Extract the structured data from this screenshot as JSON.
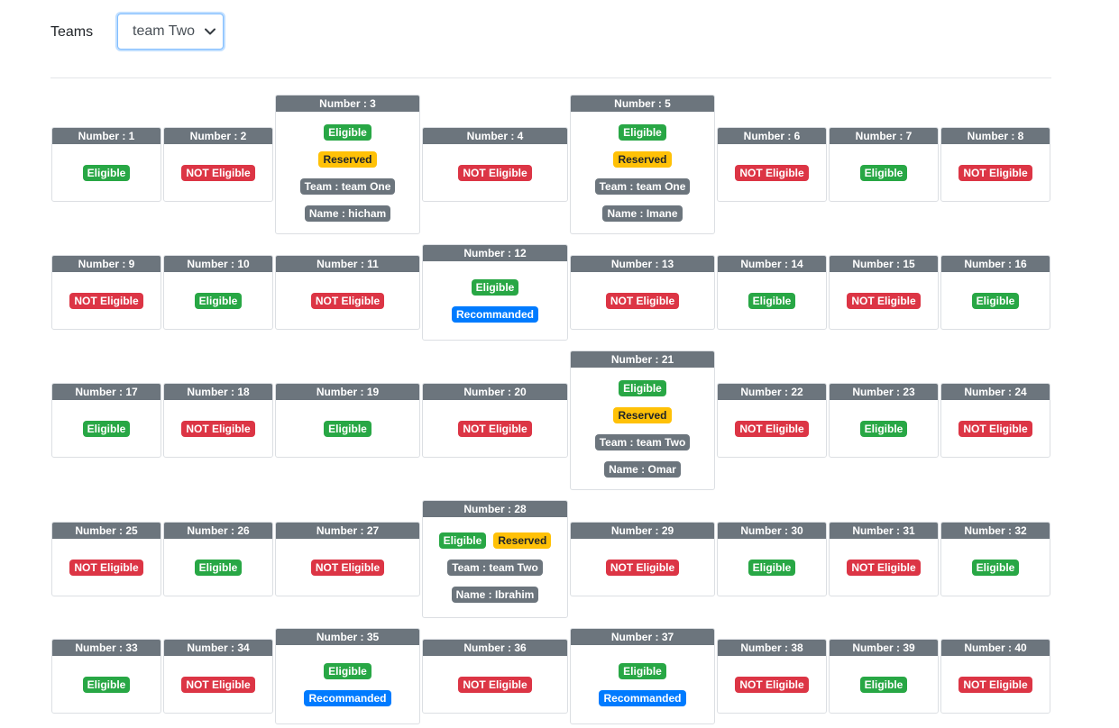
{
  "filter": {
    "label": "Teams",
    "selected": "team Two"
  },
  "colors": {
    "eligible": "#28a745",
    "not_eligible": "#dc3545",
    "reserved": "#ffc107",
    "recommended": "#007bff",
    "header": "#6c757d"
  },
  "cards": [
    {
      "title": "Number : 1",
      "badges": [
        {
          "text": "Eligible",
          "type": "eligible"
        }
      ]
    },
    {
      "title": "Number : 2",
      "badges": [
        {
          "text": "NOT Eligible",
          "type": "not-eligible"
        }
      ]
    },
    {
      "title": "Number : 3",
      "badges": [
        {
          "text": "Eligible",
          "type": "eligible"
        },
        {
          "text": "Reserved",
          "type": "reserved"
        },
        {
          "text": "Team : team One",
          "type": "info"
        },
        {
          "text": "Name : hicham",
          "type": "info"
        }
      ]
    },
    {
      "title": "Number : 4",
      "badges": [
        {
          "text": "NOT Eligible",
          "type": "not-eligible"
        }
      ]
    },
    {
      "title": "Number : 5",
      "badges": [
        {
          "text": "Eligible",
          "type": "eligible"
        },
        {
          "text": "Reserved",
          "type": "reserved"
        },
        {
          "text": "Team : team One",
          "type": "info"
        },
        {
          "text": "Name : Imane",
          "type": "info"
        }
      ]
    },
    {
      "title": "Number : 6",
      "badges": [
        {
          "text": "NOT Eligible",
          "type": "not-eligible"
        }
      ]
    },
    {
      "title": "Number : 7",
      "badges": [
        {
          "text": "Eligible",
          "type": "eligible"
        }
      ]
    },
    {
      "title": "Number : 8",
      "badges": [
        {
          "text": "NOT Eligible",
          "type": "not-eligible"
        }
      ]
    },
    {
      "title": "Number : 9",
      "badges": [
        {
          "text": "NOT Eligible",
          "type": "not-eligible"
        }
      ]
    },
    {
      "title": "Number : 10",
      "badges": [
        {
          "text": "Eligible",
          "type": "eligible"
        }
      ]
    },
    {
      "title": "Number : 11",
      "badges": [
        {
          "text": "NOT Eligible",
          "type": "not-eligible"
        }
      ]
    },
    {
      "title": "Number : 12",
      "badges": [
        {
          "text": "Eligible",
          "type": "eligible"
        },
        {
          "text": "Recommanded",
          "type": "recommended"
        }
      ]
    },
    {
      "title": "Number : 13",
      "badges": [
        {
          "text": "NOT Eligible",
          "type": "not-eligible"
        }
      ]
    },
    {
      "title": "Number : 14",
      "badges": [
        {
          "text": "Eligible",
          "type": "eligible"
        }
      ]
    },
    {
      "title": "Number : 15",
      "badges": [
        {
          "text": "NOT Eligible",
          "type": "not-eligible"
        }
      ]
    },
    {
      "title": "Number : 16",
      "badges": [
        {
          "text": "Eligible",
          "type": "eligible"
        }
      ]
    },
    {
      "title": "Number : 17",
      "badges": [
        {
          "text": "Eligible",
          "type": "eligible"
        }
      ]
    },
    {
      "title": "Number : 18",
      "badges": [
        {
          "text": "NOT Eligible",
          "type": "not-eligible"
        }
      ]
    },
    {
      "title": "Number : 19",
      "badges": [
        {
          "text": "Eligible",
          "type": "eligible"
        }
      ]
    },
    {
      "title": "Number : 20",
      "badges": [
        {
          "text": "NOT Eligible",
          "type": "not-eligible"
        }
      ]
    },
    {
      "title": "Number : 21",
      "badges": [
        {
          "text": "Eligible",
          "type": "eligible"
        },
        {
          "text": "Reserved",
          "type": "reserved"
        },
        {
          "text": "Team : team Two",
          "type": "info"
        },
        {
          "text": "Name : Omar",
          "type": "info"
        }
      ]
    },
    {
      "title": "Number : 22",
      "badges": [
        {
          "text": "NOT Eligible",
          "type": "not-eligible"
        }
      ]
    },
    {
      "title": "Number : 23",
      "badges": [
        {
          "text": "Eligible",
          "type": "eligible"
        }
      ]
    },
    {
      "title": "Number : 24",
      "badges": [
        {
          "text": "NOT Eligible",
          "type": "not-eligible"
        }
      ]
    },
    {
      "title": "Number : 25",
      "badges": [
        {
          "text": "NOT Eligible",
          "type": "not-eligible"
        }
      ]
    },
    {
      "title": "Number : 26",
      "badges": [
        {
          "text": "Eligible",
          "type": "eligible"
        }
      ]
    },
    {
      "title": "Number : 27",
      "badges": [
        {
          "text": "NOT Eligible",
          "type": "not-eligible"
        }
      ]
    },
    {
      "title": "Number : 28",
      "badges": [
        {
          "text": "Eligible",
          "type": "eligible"
        },
        {
          "text": "Reserved",
          "type": "reserved"
        },
        {
          "text": "Team : team Two",
          "type": "info"
        },
        {
          "text": "Name : Ibrahim",
          "type": "info"
        }
      ]
    },
    {
      "title": "Number : 29",
      "badges": [
        {
          "text": "NOT Eligible",
          "type": "not-eligible"
        }
      ]
    },
    {
      "title": "Number : 30",
      "badges": [
        {
          "text": "Eligible",
          "type": "eligible"
        }
      ]
    },
    {
      "title": "Number : 31",
      "badges": [
        {
          "text": "NOT Eligible",
          "type": "not-eligible"
        }
      ]
    },
    {
      "title": "Number : 32",
      "badges": [
        {
          "text": "Eligible",
          "type": "eligible"
        }
      ]
    },
    {
      "title": "Number : 33",
      "badges": [
        {
          "text": "Eligible",
          "type": "eligible"
        }
      ]
    },
    {
      "title": "Number : 34",
      "badges": [
        {
          "text": "NOT Eligible",
          "type": "not-eligible"
        }
      ]
    },
    {
      "title": "Number : 35",
      "badges": [
        {
          "text": "Eligible",
          "type": "eligible"
        },
        {
          "text": "Recommanded",
          "type": "recommended"
        }
      ]
    },
    {
      "title": "Number : 36",
      "badges": [
        {
          "text": "NOT Eligible",
          "type": "not-eligible"
        }
      ]
    },
    {
      "title": "Number : 37",
      "badges": [
        {
          "text": "Eligible",
          "type": "eligible"
        },
        {
          "text": "Recommanded",
          "type": "recommended"
        }
      ]
    },
    {
      "title": "Number : 38",
      "badges": [
        {
          "text": "NOT Eligible",
          "type": "not-eligible"
        }
      ]
    },
    {
      "title": "Number : 39",
      "badges": [
        {
          "text": "Eligible",
          "type": "eligible"
        }
      ]
    },
    {
      "title": "Number : 40",
      "badges": [
        {
          "text": "NOT Eligible",
          "type": "not-eligible"
        }
      ]
    }
  ]
}
